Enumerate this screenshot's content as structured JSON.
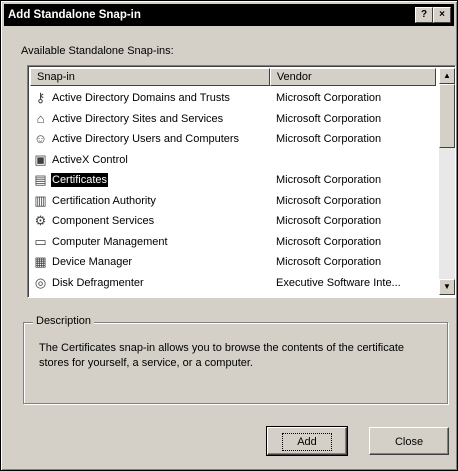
{
  "window": {
    "title": "Add Standalone Snap-in",
    "help_glyph": "?",
    "close_glyph": "×"
  },
  "available_label": "Available Standalone Snap-ins:",
  "list": {
    "columns": [
      "Snap-in",
      "Vendor"
    ],
    "rows": [
      {
        "name": "Active Directory Domains and Trusts",
        "vendor": "Microsoft Corporation",
        "icon": "domains-trusts-icon",
        "selected": false
      },
      {
        "name": "Active Directory Sites and Services",
        "vendor": "Microsoft Corporation",
        "icon": "sites-services-icon",
        "selected": false
      },
      {
        "name": "Active Directory Users and Computers",
        "vendor": "Microsoft Corporation",
        "icon": "users-computers-icon",
        "selected": false
      },
      {
        "name": "ActiveX Control",
        "vendor": "",
        "icon": "activex-control-icon",
        "selected": false
      },
      {
        "name": "Certificates",
        "vendor": "Microsoft Corporation",
        "icon": "certificates-icon",
        "selected": true
      },
      {
        "name": "Certification Authority",
        "vendor": "Microsoft Corporation",
        "icon": "certification-authority-icon",
        "selected": false
      },
      {
        "name": "Component Services",
        "vendor": "Microsoft Corporation",
        "icon": "component-services-icon",
        "selected": false
      },
      {
        "name": "Computer Management",
        "vendor": "Microsoft Corporation",
        "icon": "computer-management-icon",
        "selected": false
      },
      {
        "name": "Device Manager",
        "vendor": "Microsoft Corporation",
        "icon": "device-manager-icon",
        "selected": false
      },
      {
        "name": "Disk Defragmenter",
        "vendor": "Executive Software Inte...",
        "icon": "disk-defragmenter-icon",
        "selected": false
      }
    ]
  },
  "description": {
    "label": "Description",
    "text": "The Certificates snap-in allows you to browse the contents of the certificate stores for yourself, a service, or a computer."
  },
  "buttons": {
    "add": "Add",
    "close": "Close"
  },
  "colors": {
    "titlebar": "#000000",
    "dialog_face": "#d4d0c8",
    "selection": "#000000"
  }
}
